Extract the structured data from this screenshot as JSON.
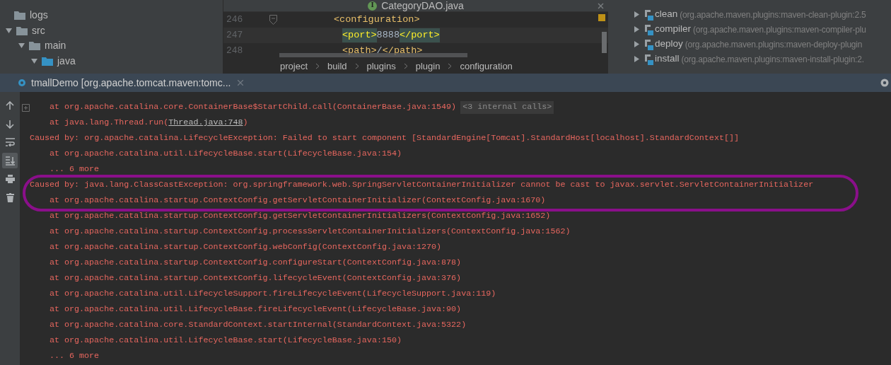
{
  "project_tree": [
    {
      "label": "logs",
      "kind": "folder"
    },
    {
      "label": "src",
      "kind": "folder",
      "expanded": true,
      "children": [
        {
          "label": "main",
          "kind": "folder",
          "expanded": true,
          "children": [
            {
              "label": "java",
              "kind": "source",
              "expanded": true
            }
          ]
        }
      ]
    }
  ],
  "editor": {
    "tab": {
      "icon_letter": "I",
      "title": "CategoryDAO.java"
    },
    "lines": [
      {
        "number": "246",
        "fold": true,
        "parts": [
          {
            "text": "<configuration>",
            "kind": "tag",
            "match": false
          }
        ],
        "children": [
          {
            "number": "247",
            "fold": false,
            "parts": [
              {
                "text": "<port>",
                "kind": "tag",
                "match": true
              },
              {
                "text": "8888",
                "kind": "text",
                "match": false
              },
              {
                "text": "</port>",
                "kind": "tag",
                "match": true
              }
            ]
          },
          {
            "number": "248",
            "fold": false,
            "parts": [
              {
                "text": "<path>",
                "kind": "tag",
                "match": false
              },
              {
                "text": "/",
                "kind": "text",
                "match": false
              },
              {
                "text": "</path>",
                "kind": "tag",
                "match": false
              }
            ]
          }
        ]
      }
    ],
    "breadcrumbs": [
      "project",
      "build",
      "plugins",
      "plugin",
      "configuration"
    ]
  },
  "maven": {
    "plugins": [
      {
        "name": "clean",
        "coords": "(org.apache.maven.plugins:maven-clean-plugin:2.5",
        "expanded": false
      },
      {
        "name": "compiler",
        "coords": "(org.apache.maven.plugins:maven-compiler-plu",
        "expanded": false
      },
      {
        "name": "deploy",
        "coords": "(org.apache.maven.plugins:maven-deploy-plugin",
        "expanded": false
      },
      {
        "name": "install",
        "coords": "(org.apache.maven.plugins:maven-install-plugin:2.",
        "expanded": false
      }
    ]
  },
  "console": {
    "tab": {
      "title": "tmallDemo [org.apache.tomcat.maven:tomc..."
    },
    "toolbar": [
      {
        "kind": "up",
        "selected": false
      },
      {
        "kind": "down",
        "selected": false
      },
      {
        "kind": "wrap",
        "selected": false
      },
      {
        "kind": "scroll",
        "selected": true
      },
      {
        "kind": "print",
        "selected": false
      },
      {
        "kind": "trash",
        "selected": false
      }
    ],
    "lines": [
      {
        "kind": "at",
        "fold": true,
        "parts": [
          {
            "text": "at org.apache.catalina.core.ContainerBase$StartChild.call(ContainerBase.java:1549)",
            "kind": "plain"
          }
        ],
        "badge": "<3 internal calls>"
      },
      {
        "kind": "at",
        "fold": false,
        "parts": [
          {
            "text": "at java.lang.Thread.run(",
            "kind": "plain"
          },
          {
            "text": "Thread.java:748",
            "kind": "link"
          },
          {
            "text": ")",
            "kind": "plain"
          }
        ]
      },
      {
        "kind": "caused",
        "fold": false,
        "parts": [
          {
            "text": "Caused by: org.apache.catalina.LifecycleException: Failed to start component [StandardEngine[Tomcat].StandardHost[localhost].StandardContext[]]",
            "kind": "plain"
          }
        ]
      },
      {
        "kind": "at",
        "fold": false,
        "parts": [
          {
            "text": "at org.apache.catalina.util.LifecycleBase.start(LifecycleBase.java:154)",
            "kind": "plain"
          }
        ]
      },
      {
        "kind": "at",
        "fold": false,
        "parts": [
          {
            "text": "... 6 more",
            "kind": "plain"
          }
        ]
      },
      {
        "kind": "caused",
        "fold": false,
        "parts": [
          {
            "text": "Caused by: java.lang.ClassCastException: org.springframework.web.SpringServletContainerInitializer cannot be cast to javax.servlet.ServletContainerInitializer",
            "kind": "plain"
          }
        ]
      },
      {
        "kind": "at",
        "fold": false,
        "parts": [
          {
            "text": "at org.apache.catalina.startup.ContextConfig.getServletContainerInitializer(ContextConfig.java:1670)",
            "kind": "plain"
          }
        ]
      },
      {
        "kind": "at",
        "fold": false,
        "parts": [
          {
            "text": "at org.apache.catalina.startup.ContextConfig.getServletContainerInitializers(ContextConfig.java:1652)",
            "kind": "plain"
          }
        ]
      },
      {
        "kind": "at",
        "fold": false,
        "parts": [
          {
            "text": "at org.apache.catalina.startup.ContextConfig.processServletContainerInitializers(ContextConfig.java:1562)",
            "kind": "plain"
          }
        ]
      },
      {
        "kind": "at",
        "fold": false,
        "parts": [
          {
            "text": "at org.apache.catalina.startup.ContextConfig.webConfig(ContextConfig.java:1270)",
            "kind": "plain"
          }
        ]
      },
      {
        "kind": "at",
        "fold": false,
        "parts": [
          {
            "text": "at org.apache.catalina.startup.ContextConfig.configureStart(ContextConfig.java:878)",
            "kind": "plain"
          }
        ]
      },
      {
        "kind": "at",
        "fold": false,
        "parts": [
          {
            "text": "at org.apache.catalina.startup.ContextConfig.lifecycleEvent(ContextConfig.java:376)",
            "kind": "plain"
          }
        ]
      },
      {
        "kind": "at",
        "fold": false,
        "parts": [
          {
            "text": "at org.apache.catalina.util.LifecycleSupport.fireLifecycleEvent(LifecycleSupport.java:119)",
            "kind": "plain"
          }
        ]
      },
      {
        "kind": "at",
        "fold": false,
        "parts": [
          {
            "text": "at org.apache.catalina.util.LifecycleBase.fireLifecycleEvent(LifecycleBase.java:90)",
            "kind": "plain"
          }
        ]
      },
      {
        "kind": "at",
        "fold": false,
        "parts": [
          {
            "text": "at org.apache.catalina.core.StandardContext.startInternal(StandardContext.java:5322)",
            "kind": "plain"
          }
        ]
      },
      {
        "kind": "at",
        "fold": false,
        "parts": [
          {
            "text": "at org.apache.catalina.util.LifecycleBase.start(LifecycleBase.java:150)",
            "kind": "plain"
          }
        ]
      },
      {
        "kind": "at",
        "fold": false,
        "parts": [
          {
            "text": "... 6 more",
            "kind": "plain"
          }
        ]
      }
    ],
    "annotation": {
      "kind": "ellipse",
      "color": "#8a0f8a"
    }
  }
}
